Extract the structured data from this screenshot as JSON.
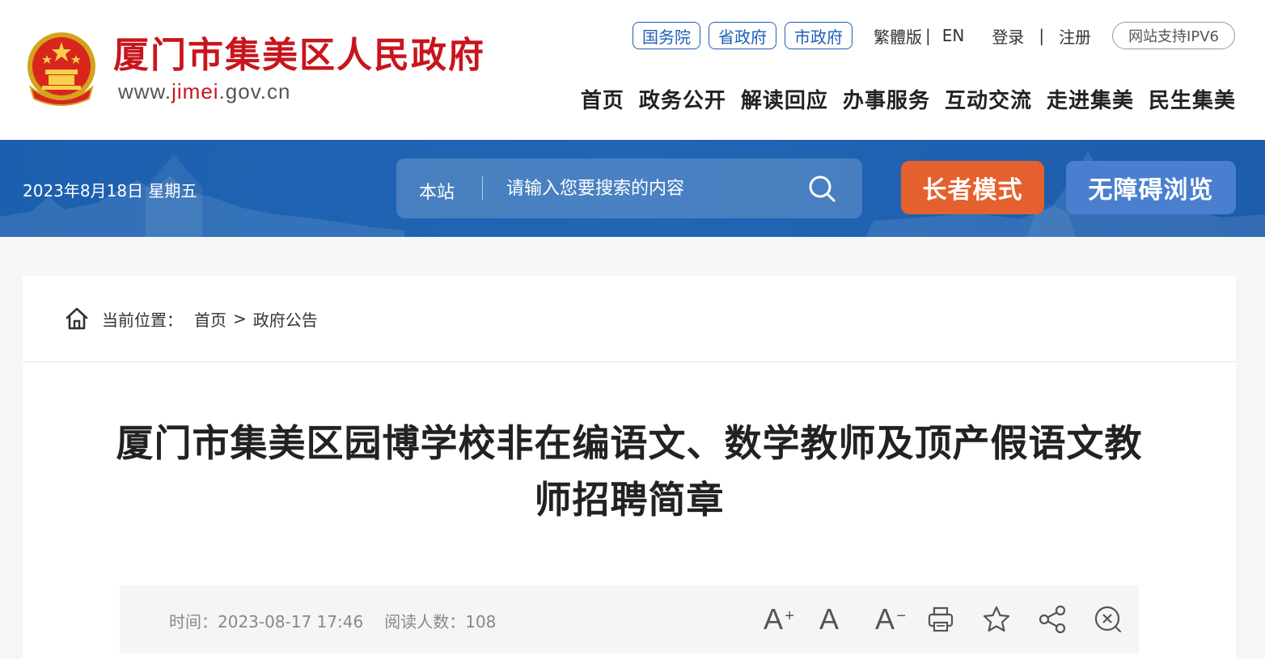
{
  "header": {
    "site_name": "厦门市集美区人民政府",
    "url_prefix": "www.",
    "url_highlight": "jimei",
    "url_suffix": ".gov.cn",
    "gov_links": [
      "国务院",
      "省政府",
      "市政府"
    ],
    "traditional": "繁體版",
    "english": "EN",
    "login": "登录",
    "register": "注册",
    "ipv6": "网站支持IPV6",
    "nav": [
      "首页",
      "政务公开",
      "解读回应",
      "办事服务",
      "互动交流",
      "走进集美",
      "民生集美"
    ]
  },
  "banner": {
    "date": "2023年8月18日 星期五",
    "search_scope": "本站",
    "search_placeholder": "请输入您要搜索的内容",
    "elder_mode": "长者模式",
    "accessibility": "无障碍浏览"
  },
  "breadcrumb": {
    "label": "当前位置：",
    "home": "首页",
    "separator": ">",
    "current": "政府公告"
  },
  "article": {
    "title": "厦门市集美区园博学校非在编语文、数学教师及顶产假语文教师招聘简章",
    "time_label": "时间：",
    "time": "2023-08-17 17:46",
    "reads_label": "阅读人数：",
    "reads": "108"
  },
  "colors": {
    "brand_red": "#c8151d",
    "banner_blue": "#1f62b2",
    "elder_orange": "#e4602e",
    "access_blue": "#4a7fd0"
  },
  "icons": [
    "national-emblem-icon",
    "search-icon",
    "home-icon",
    "font-increase-icon",
    "font-reset-icon",
    "font-decrease-icon",
    "print-icon",
    "star-icon",
    "share-icon",
    "close-icon"
  ]
}
